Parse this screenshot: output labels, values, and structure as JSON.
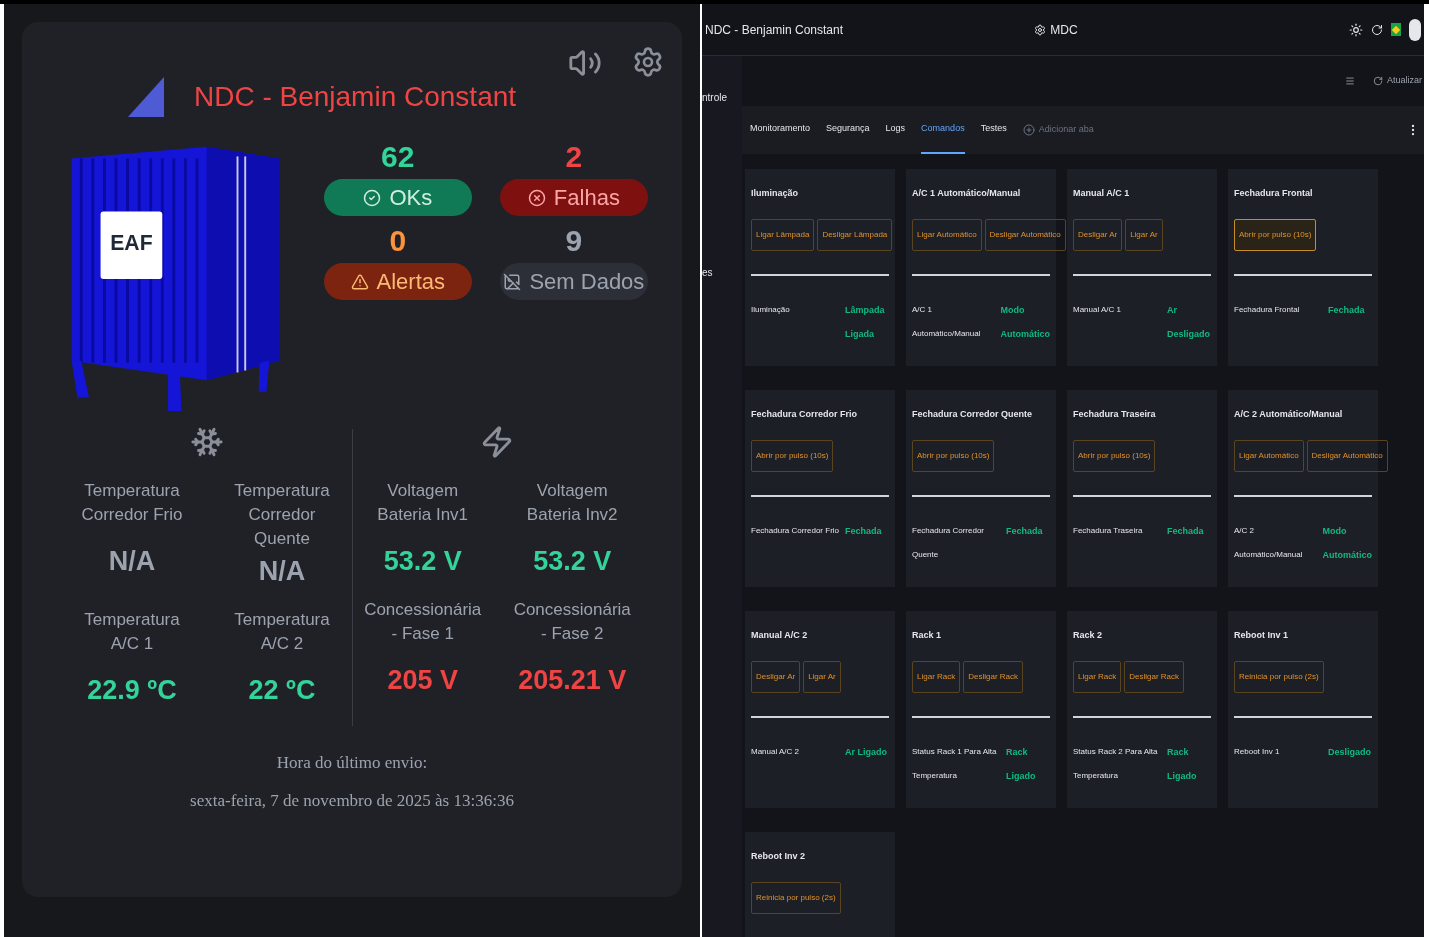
{
  "left": {
    "title": "NDC - Benjamin Constant",
    "container_logo": "EAF",
    "stats": [
      {
        "count": "62",
        "label": "OKs",
        "kind": "ok"
      },
      {
        "count": "2",
        "label": "Falhas",
        "kind": "fail"
      },
      {
        "count": "0",
        "label": "Alertas",
        "kind": "alert"
      },
      {
        "count": "9",
        "label": "Sem Dados",
        "kind": "nodata"
      }
    ],
    "groups": [
      {
        "kind": "cold",
        "metrics": [
          {
            "label": "Temperatura Corredor Frio",
            "value": "N/A",
            "kind": "na"
          },
          {
            "label": "Temperatura Corredor Quente",
            "value": "N/A",
            "kind": "na"
          },
          {
            "label": "Temperatura A/C 1",
            "value": "22.9 ºC",
            "kind": "ok"
          },
          {
            "label": "Temperatura A/C 2",
            "value": "22 ºC",
            "kind": "ok"
          }
        ]
      },
      {
        "kind": "power",
        "metrics": [
          {
            "label": "Voltagem Bateria Inv1",
            "value": "53.2 V",
            "kind": "ok"
          },
          {
            "label": "Voltagem Bateria Inv2",
            "value": "53.2 V",
            "kind": "ok"
          },
          {
            "label": "Concessionária - Fase 1",
            "value": "205 V",
            "kind": "bad"
          },
          {
            "label": "Concessionária - Fase 2",
            "value": "205.21 V",
            "kind": "bad"
          }
        ]
      }
    ],
    "footer_label": "Hora do último envio:",
    "footer_time": "sexta-feira, 7 de novembro de 2025 às 13:36:36"
  },
  "right": {
    "header_title": "NDC - Benjamin Constant",
    "brand": "MDC",
    "sidebar": [
      "ntrole",
      "es"
    ],
    "refresh": "Atualizar",
    "tabs": [
      {
        "label": "Monitoramento",
        "selected": false
      },
      {
        "label": "Segurança",
        "selected": false
      },
      {
        "label": "Logs",
        "selected": false
      },
      {
        "label": "Comandos",
        "selected": true
      },
      {
        "label": "Testes",
        "selected": false
      }
    ],
    "add_tab": "Adicionar aba",
    "cards": [
      {
        "title": "Iluminação",
        "buttons": [
          {
            "label": "Ligar Lâmpada",
            "focused": false
          },
          {
            "label": "Desligar Lâmpada",
            "focused": false
          }
        ],
        "status_label": "Iluminação",
        "status_value": "Lâmpada Ligada"
      },
      {
        "title": "A/C 1 Automático/Manual",
        "buttons": [
          {
            "label": "Ligar Automático",
            "focused": false
          },
          {
            "label": "Desligar Automático",
            "focused": false
          }
        ],
        "status_label": "A/C 1 Automático/Manual",
        "status_value": "Modo Automático"
      },
      {
        "title": "Manual A/C 1",
        "buttons": [
          {
            "label": "Desligar Ar",
            "focused": false
          },
          {
            "label": "Ligar Ar",
            "focused": false
          }
        ],
        "status_label": "Manual A/C 1",
        "status_value": "Ar Desligado"
      },
      {
        "title": "Fechadura Frontal",
        "buttons": [
          {
            "label": "Abrir por pulso (10s)",
            "focused": true
          }
        ],
        "status_label": "Fechadura Frontal",
        "status_value": "Fechada"
      },
      {
        "title": "Fechadura Corredor Frio",
        "buttons": [
          {
            "label": "Abrir por pulso (10s)",
            "focused": false
          }
        ],
        "status_label": "Fechadura Corredor Frio",
        "status_value": "Fechada"
      },
      {
        "title": "Fechadura Corredor Quente",
        "buttons": [
          {
            "label": "Abrir por pulso (10s)",
            "focused": false
          }
        ],
        "status_label": "Fechadura Corredor Quente",
        "status_value": "Fechada"
      },
      {
        "title": "Fechadura Traseira",
        "buttons": [
          {
            "label": "Abrir por pulso (10s)",
            "focused": false
          }
        ],
        "status_label": "Fechadura Traseira",
        "status_value": "Fechada"
      },
      {
        "title": "A/C 2 Automático/Manual",
        "buttons": [
          {
            "label": "Ligar Automático",
            "focused": false
          },
          {
            "label": "Desligar Automático",
            "focused": false
          }
        ],
        "status_label": "A/C 2 Automático/Manual",
        "status_value": "Modo Automático"
      },
      {
        "title": "Manual A/C 2",
        "buttons": [
          {
            "label": "Desligar Ar",
            "focused": false
          },
          {
            "label": "Ligar Ar",
            "focused": false
          }
        ],
        "status_label": "Manual A/C 2",
        "status_value": "Ar Ligado"
      },
      {
        "title": "Rack 1",
        "buttons": [
          {
            "label": "Ligar Rack",
            "focused": false
          },
          {
            "label": "Desligar Rack",
            "focused": false
          }
        ],
        "status_label": "Status Rack 1 Para Alta Temperatura",
        "status_value": "Rack Ligado"
      },
      {
        "title": "Rack 2",
        "buttons": [
          {
            "label": "Ligar Rack",
            "focused": false
          },
          {
            "label": "Desligar Rack",
            "focused": false
          }
        ],
        "status_label": "Status Rack 2 Para Alta Temperatura",
        "status_value": "Rack Ligado"
      },
      {
        "title": "Reboot Inv 1",
        "buttons": [
          {
            "label": "Reinicia por pulso (2s)",
            "focused": false
          }
        ],
        "status_label": "Reboot Inv 1",
        "status_value": "Desligado"
      },
      {
        "title": "Reboot Inv 2",
        "buttons": [
          {
            "label": "Reinicia por pulso (2s)",
            "focused": false
          }
        ]
      }
    ]
  }
}
